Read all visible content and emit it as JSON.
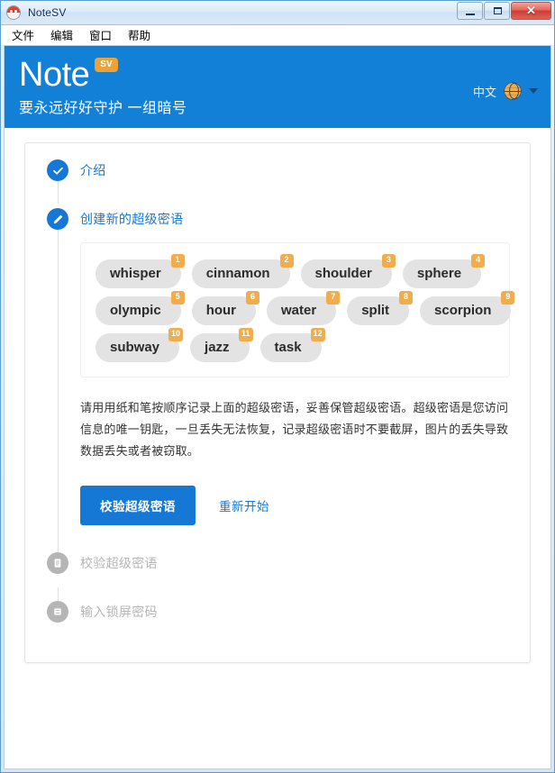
{
  "window": {
    "title": "NoteSV",
    "app_icon": "notesv-app-icon",
    "controls": {
      "minimize": "minimize-icon",
      "maximize": "maximize-icon",
      "close": "✕"
    }
  },
  "menubar": {
    "items": [
      {
        "label": "文件",
        "name": "menu-file"
      },
      {
        "label": "编辑",
        "name": "menu-edit"
      },
      {
        "label": "窗口",
        "name": "menu-window"
      },
      {
        "label": "帮助",
        "name": "menu-help"
      }
    ]
  },
  "header": {
    "brand": "Note",
    "brand_badge": "SV",
    "tagline": "要永远好好守护 一组暗号",
    "language": "中文",
    "globe_icon": "globe-icon",
    "caret_icon": "chevron-down-icon",
    "background_color": "#1380d8",
    "accent_color": "#f0ad4e"
  },
  "steps": [
    {
      "label": "介绍",
      "state": "done",
      "icon": "check-icon"
    },
    {
      "label": "创建新的超级密语",
      "state": "active",
      "icon": "pencil-icon"
    },
    {
      "label": "校验超级密语",
      "state": "disabled",
      "icon": "document-icon"
    },
    {
      "label": "输入锁屏密码",
      "state": "disabled",
      "icon": "keypad-icon"
    }
  ],
  "passphrase": {
    "rows": [
      [
        {
          "number": "1",
          "word": "whisper"
        },
        {
          "number": "2",
          "word": "cinnamon"
        },
        {
          "number": "3",
          "word": "shoulder"
        },
        {
          "number": "4",
          "word": "sphere"
        }
      ],
      [
        {
          "number": "5",
          "word": "olympic"
        },
        {
          "number": "6",
          "word": "hour"
        },
        {
          "number": "7",
          "word": "water"
        },
        {
          "number": "8",
          "word": "split"
        },
        {
          "number": "9",
          "word": "scorpion"
        }
      ],
      [
        {
          "number": "10",
          "word": "subway"
        },
        {
          "number": "11",
          "word": "jazz"
        },
        {
          "number": "12",
          "word": "task"
        }
      ]
    ]
  },
  "notice": "请用用纸和笔按顺序记录上面的超级密语，妥善保管超级密语。超级密语是您访问信息的唯一钥匙，一旦丢失无法恢复，记录超级密语时不要截屏，图片的丢失导致数据丢失或者被窃取。",
  "actions": {
    "primary_label": "校验超级密语",
    "restart_label": "重新开始"
  }
}
